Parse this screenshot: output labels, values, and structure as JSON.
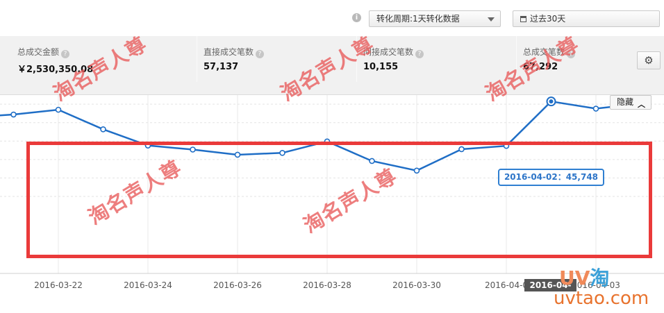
{
  "toolbar": {
    "info_icon": "i",
    "period_select": "转化周期:1天转化数据",
    "date_range": "过去30天"
  },
  "metrics": [
    {
      "label": "总成交金额",
      "value": "￥2,530,350.08"
    },
    {
      "label": "直接成交笔数",
      "value": "57,137"
    },
    {
      "label": "间接成交笔数",
      "value": "10,155"
    },
    {
      "label": "总成交笔数",
      "value": "67,292"
    }
  ],
  "chart_controls": {
    "hide_label": "隐藏"
  },
  "chart_data": {
    "type": "line",
    "x": [
      "2016-03-20",
      "2016-03-21",
      "2016-03-22",
      "2016-03-23",
      "2016-03-24",
      "2016-03-25",
      "2016-03-26",
      "2016-03-27",
      "2016-03-28",
      "2016-03-29",
      "2016-03-30",
      "2016-03-31",
      "2016-04-01",
      "2016-04-02",
      "2016-04-03",
      "2016-04-04"
    ],
    "values": [
      null,
      42200,
      43500,
      38200,
      33800,
      32700,
      31300,
      31800,
      34900,
      29600,
      27000,
      32800,
      33700,
      45748,
      43800,
      45200
    ],
    "tick_labels": [
      "2016-03-22",
      "2016-03-24",
      "2016-03-26",
      "2016-03-28",
      "2016-03-30",
      "2016-04-0",
      "2016-04-03"
    ],
    "tick_dates": [
      "2016-03-22",
      "2016-03-24",
      "2016-03-26",
      "2016-03-28",
      "2016-03-30",
      "2016-04-01",
      "2016-04-03"
    ],
    "ylim": [
      20000,
      55000
    ],
    "grid": true,
    "highlight": {
      "date": "2016-04-02",
      "value": 45748
    },
    "tooltip": "2016-04-02：45,748",
    "x_tag": "2016-04-02",
    "color": "#1f6ec6"
  },
  "watermarks": [
    "淘名声人尊",
    "淘名声人尊",
    "淘名声人尊",
    "淘名声人尊",
    "淘名声人尊"
  ],
  "logo": {
    "uv": "UV",
    "tao": "淘",
    "url": "uvtao.com"
  }
}
